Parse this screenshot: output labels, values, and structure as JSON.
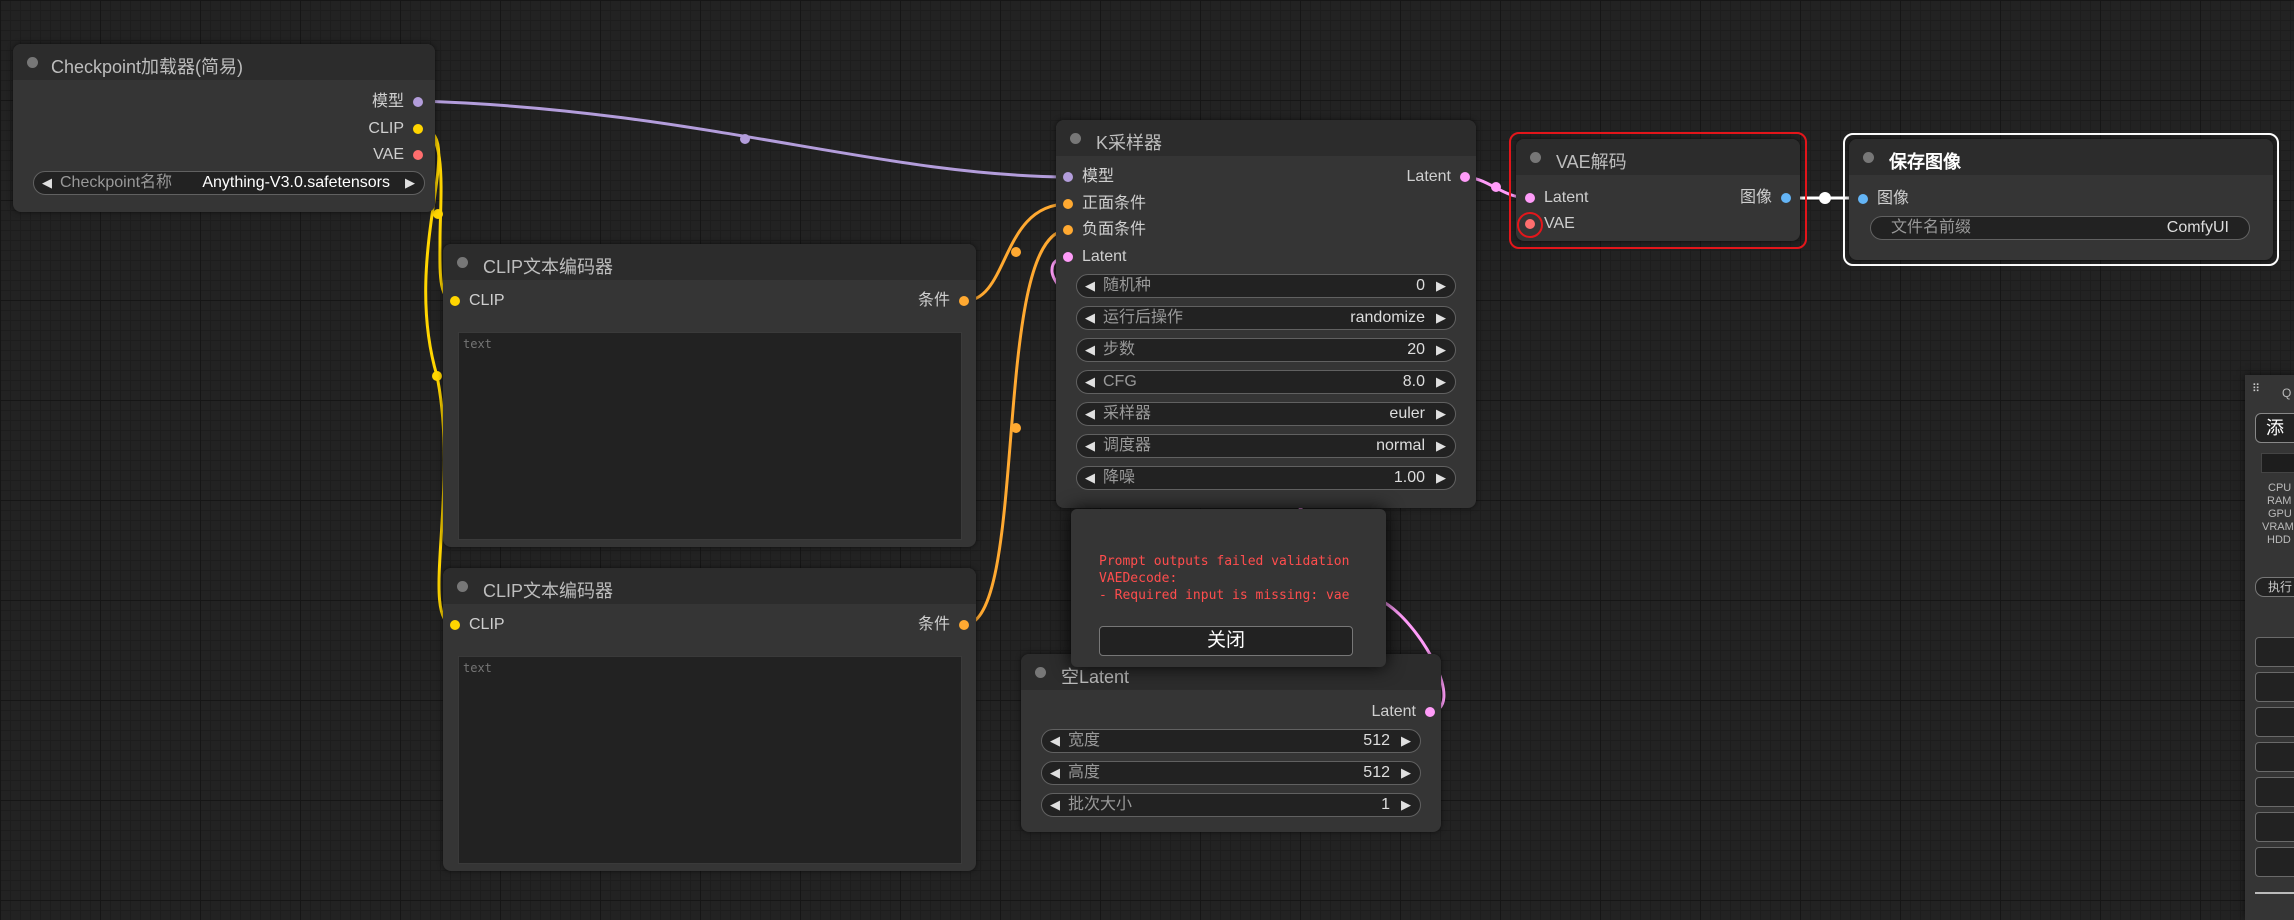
{
  "colors": {
    "model": "#b39ddb",
    "clip": "#ffd500",
    "vae": "#ff6e6e",
    "conditioning": "#ffa931",
    "latent": "#ff9cf9",
    "image": "#64b5f6",
    "error_outline": "#e4161b",
    "selected_outline": "#ffffff",
    "error_text": "#ff4d4d"
  },
  "checkpoint_loader": {
    "title": "Checkpoint加载器(简易)",
    "outputs": [
      "模型",
      "CLIP",
      "VAE"
    ],
    "ckpt_label": "Checkpoint名称",
    "ckpt_value": "Anything-V3.0.safetensors"
  },
  "clip_encoder_1": {
    "title": "CLIP文本编码器",
    "input": "CLIP",
    "output": "条件",
    "placeholder": "text"
  },
  "clip_encoder_2": {
    "title": "CLIP文本编码器",
    "input": "CLIP",
    "output": "条件",
    "placeholder": "text"
  },
  "ksampler": {
    "title": "K采样器",
    "inputs": [
      "模型",
      "正面条件",
      "负面条件",
      "Latent"
    ],
    "output": "Latent",
    "widgets": [
      {
        "label": "随机种",
        "value": "0"
      },
      {
        "label": "运行后操作",
        "value": "randomize"
      },
      {
        "label": "步数",
        "value": "20"
      },
      {
        "label": "CFG",
        "value": "8.0"
      },
      {
        "label": "采样器",
        "value": "euler"
      },
      {
        "label": "调度器",
        "value": "normal"
      },
      {
        "label": "降噪",
        "value": "1.00"
      }
    ]
  },
  "vae_decode": {
    "title": "VAE解码",
    "inputs": [
      "Latent",
      "VAE"
    ],
    "output": "图像"
  },
  "save_image": {
    "title": "保存图像",
    "input": "图像",
    "prefix_label": "文件名前缀",
    "prefix_value": "ComfyUI"
  },
  "empty_latent": {
    "title": "空Latent",
    "output": "Latent",
    "widgets": [
      {
        "label": "宽度",
        "value": "512"
      },
      {
        "label": "高度",
        "value": "512"
      },
      {
        "label": "批次大小",
        "value": "1"
      }
    ]
  },
  "error_dialog": {
    "message": "Prompt outputs failed validation\nVAEDecode:\n- Required input is missing: vae",
    "close_label": "关闭"
  },
  "side_panel": {
    "grip_icon": "⠿",
    "title": "Q",
    "add_button": "添",
    "stats": [
      "CPU",
      "RAM",
      "GPU",
      "VRAM",
      "HDD"
    ],
    "run_button": "执行"
  }
}
